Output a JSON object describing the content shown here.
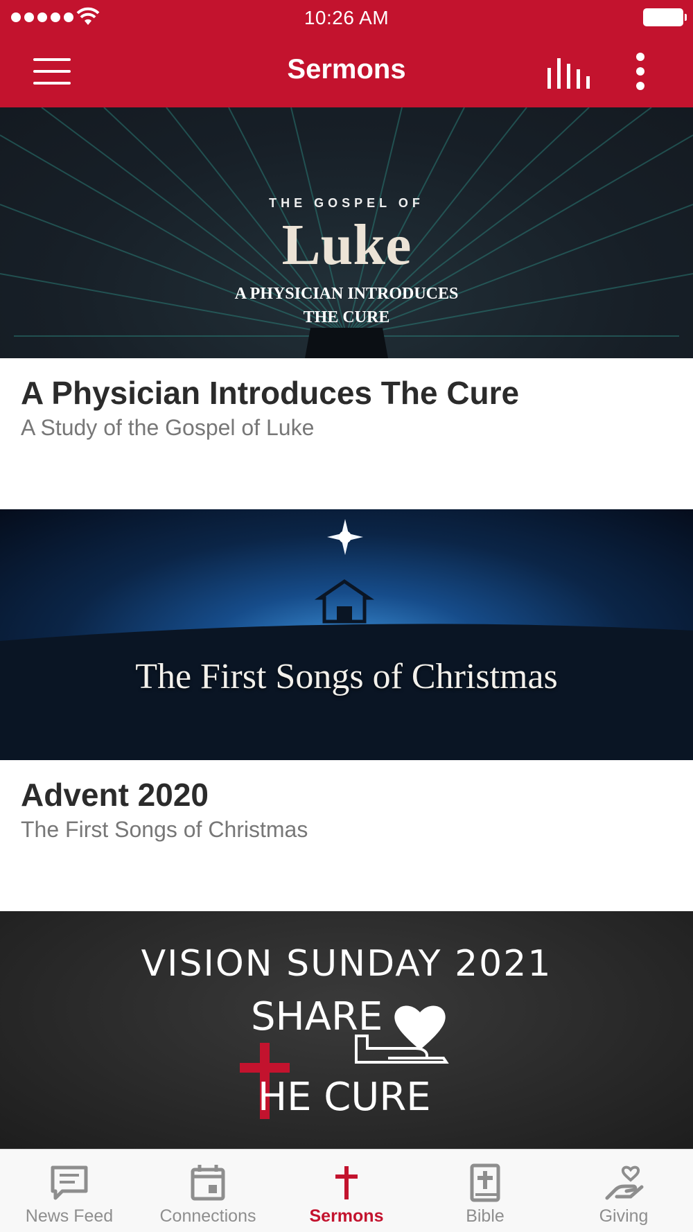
{
  "status_bar": {
    "time": "10:26 AM"
  },
  "nav": {
    "title": "Sermons"
  },
  "sermons": [
    {
      "title": "A Physician Introduces The Cure",
      "subtitle": "A Study of the Gospel of Luke",
      "banner": {
        "kicker": "THE GOSPEL OF",
        "headline": "Luke",
        "tagline_1": "A PHYSICIAN INTRODUCES",
        "tagline_2": "THE CURE"
      }
    },
    {
      "title": "Advent 2020",
      "subtitle": "The First Songs of Christmas",
      "banner": {
        "headline": "The First Songs of Christmas"
      }
    },
    {
      "banner": {
        "line_1": "VISION SUNDAY 2021",
        "line_2": "SHARE",
        "line_3": "HE CURE"
      }
    }
  ],
  "tabs": [
    {
      "label": "News Feed",
      "icon": "news-feed-icon"
    },
    {
      "label": "Connections",
      "icon": "calendar-icon"
    },
    {
      "label": "Sermons",
      "icon": "cross-icon",
      "active": true
    },
    {
      "label": "Bible",
      "icon": "bible-icon"
    },
    {
      "label": "Giving",
      "icon": "giving-icon"
    }
  ],
  "colors": {
    "brand": "#c3132e",
    "tab_inactive": "#8e8e8e",
    "title_text": "#2b2b2b",
    "subtitle_text": "#777777"
  }
}
